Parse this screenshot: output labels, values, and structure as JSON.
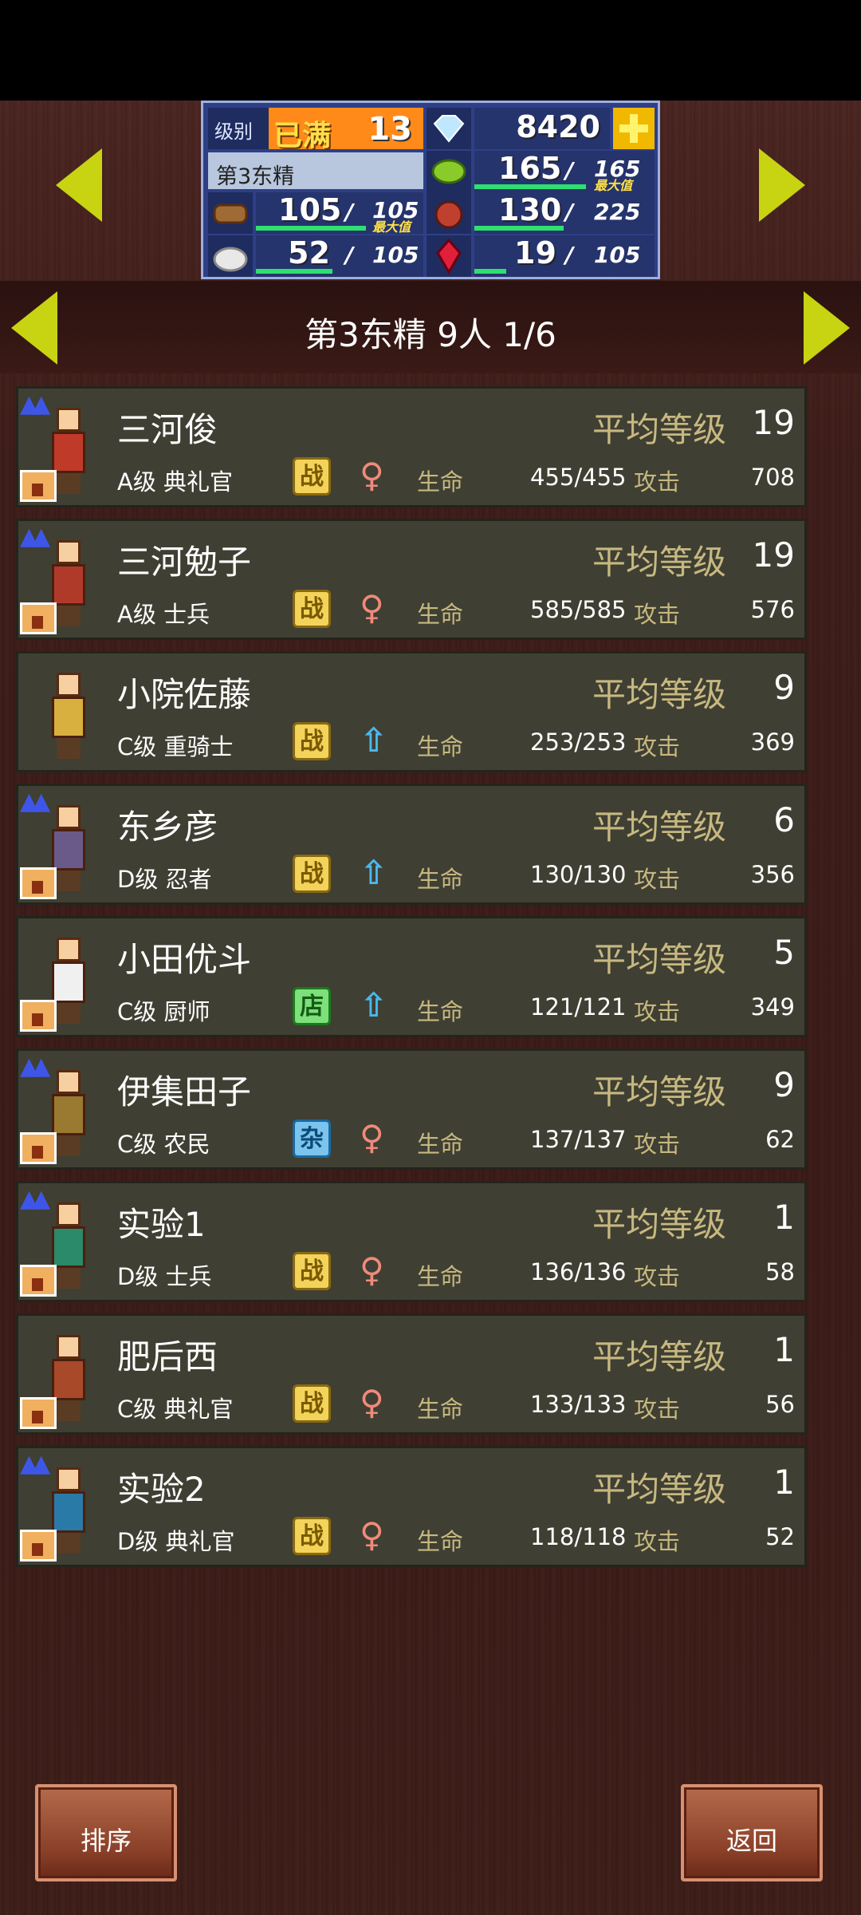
{
  "stats": {
    "level_label": "级别",
    "level_status": "已满",
    "level_value": "13",
    "diamonds": "8420",
    "dorm_name": "第3东精",
    "grass_current": "165",
    "grass_max": "165",
    "grass_max_tag": "最大值",
    "wood_current": "105",
    "wood_max": "105",
    "wood_max_tag": "最大值",
    "food_current": "130",
    "food_max": "225",
    "stone_current": "52",
    "stone_max": "105",
    "gem_current": "19",
    "gem_max": "105"
  },
  "header": {
    "title": "第3东精  9人 1/6"
  },
  "labels": {
    "avg_level": "平均等级",
    "life": "生命",
    "attack": "攻击"
  },
  "roster": [
    {
      "name": "三河俊",
      "rank": "A级 典礼官",
      "role": "战",
      "role_type": "fight",
      "gender": "♀",
      "gender_type": "f",
      "avg": "19",
      "life": "455/455",
      "attack": "708",
      "tags": "people+house"
    },
    {
      "name": "三河勉子",
      "rank": "A级 士兵",
      "role": "战",
      "role_type": "fight",
      "gender": "♀",
      "gender_type": "f",
      "avg": "19",
      "life": "585/585",
      "attack": "576",
      "tags": "people+house"
    },
    {
      "name": "小院佐藤",
      "rank": "C级 重骑士",
      "role": "战",
      "role_type": "fight",
      "gender": "⇧",
      "gender_type": "m",
      "avg": "9",
      "life": "253/253",
      "attack": "369",
      "tags": "none"
    },
    {
      "name": "东乡彦",
      "rank": "D级 忍者",
      "role": "战",
      "role_type": "fight",
      "gender": "⇧",
      "gender_type": "m",
      "avg": "6",
      "life": "130/130",
      "attack": "356",
      "tags": "people+house"
    },
    {
      "name": "小田优斗",
      "rank": "C级 厨师",
      "role": "店",
      "role_type": "shop",
      "gender": "⇧",
      "gender_type": "m",
      "avg": "5",
      "life": "121/121",
      "attack": "349",
      "tags": "house"
    },
    {
      "name": "伊集田子",
      "rank": "C级 农民",
      "role": "杂",
      "role_type": "misc",
      "gender": "♀",
      "gender_type": "f",
      "avg": "9",
      "life": "137/137",
      "attack": "62",
      "tags": "people+house"
    },
    {
      "name": "实验1",
      "rank": "D级 士兵",
      "role": "战",
      "role_type": "fight",
      "gender": "♀",
      "gender_type": "f",
      "avg": "1",
      "life": "136/136",
      "attack": "58",
      "tags": "people+house"
    },
    {
      "name": "肥后西",
      "rank": "C级 典礼官",
      "role": "战",
      "role_type": "fight",
      "gender": "♀",
      "gender_type": "f",
      "avg": "1",
      "life": "133/133",
      "attack": "56",
      "tags": "house"
    },
    {
      "name": "实验2",
      "rank": "D级 典礼官",
      "role": "战",
      "role_type": "fight",
      "gender": "♀",
      "gender_type": "f",
      "avg": "1",
      "life": "118/118",
      "attack": "52",
      "tags": "people+house"
    }
  ],
  "buttons": {
    "sort": "排序",
    "back": "返回"
  },
  "colors": {
    "row_bg": "#3f3f33",
    "label_gold": "#c7b880",
    "arrow_green": "#c8d312",
    "panel_blue": "#2f3f86"
  }
}
